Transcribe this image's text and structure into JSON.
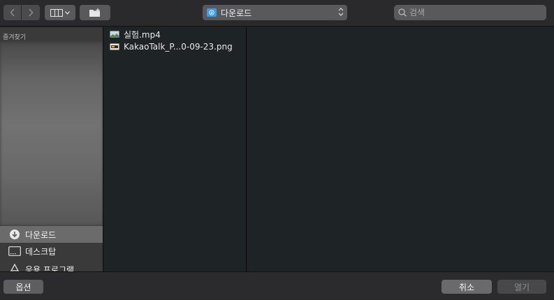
{
  "toolbar": {
    "back_icon": "chevron-left-icon",
    "forward_icon": "chevron-right-icon",
    "view_icon": "column-view-icon",
    "new_folder_icon": "new-folder-icon",
    "location": {
      "label": "다운로드",
      "icon": "downloads-folder-icon"
    },
    "search": {
      "placeholder": "검색",
      "value": ""
    }
  },
  "sidebar": {
    "heading": "즐겨찾기",
    "items": [
      {
        "label": "다운로드",
        "icon": "download-icon",
        "selected": true
      },
      {
        "label": "데스크탑",
        "icon": "desktop-icon",
        "selected": false
      },
      {
        "label": "응용 프로그램",
        "icon": "applications-icon",
        "selected": false
      }
    ]
  },
  "files": [
    {
      "name": "실험.mp4",
      "icon": "video-file-icon"
    },
    {
      "name": "KakaoTalk_P...0-09-23.png",
      "icon": "image-file-icon"
    }
  ],
  "buttons": {
    "options": "옵션",
    "cancel": "취소",
    "open": "열기"
  },
  "colors": {
    "accent_blue": "#3a9ee4",
    "selected_row": "#6b6b6c",
    "file_bg": "#1e2326"
  }
}
